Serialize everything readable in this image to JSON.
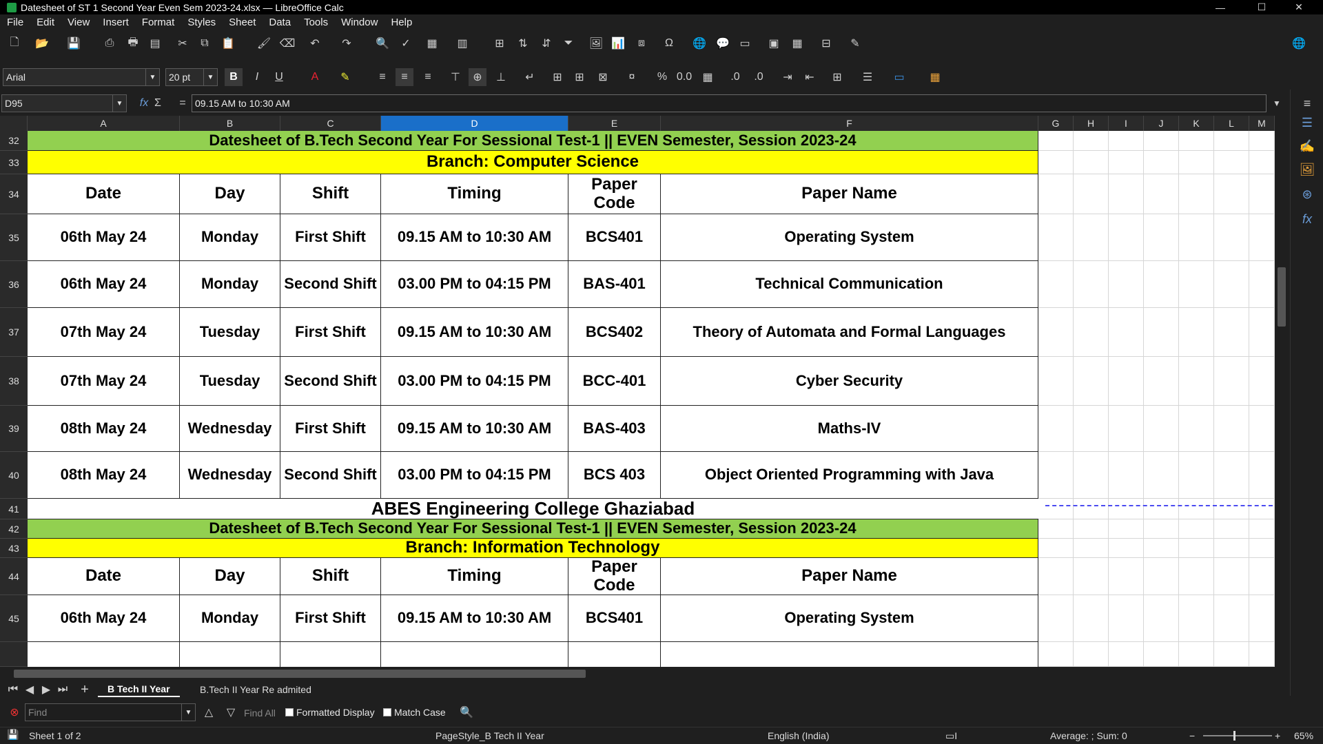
{
  "window": {
    "title": "Datesheet of ST 1 Second Year Even Sem 2023-24.xlsx — LibreOffice Calc",
    "minimize": "—",
    "maximize": "☐",
    "close": "✕"
  },
  "menu": [
    "File",
    "Edit",
    "View",
    "Insert",
    "Format",
    "Styles",
    "Sheet",
    "Data",
    "Tools",
    "Window",
    "Help"
  ],
  "formatting": {
    "font_name": "Arial",
    "font_size": "20 pt",
    "bold": "B",
    "italic": "I",
    "underline": "U"
  },
  "formula_bar": {
    "cell_ref": "D95",
    "content": "09.15 AM to 10:30 AM",
    "fx": "fx",
    "sigma": "Σ",
    "equals": "="
  },
  "columns": [
    "A",
    "B",
    "C",
    "D",
    "E",
    "F",
    "G",
    "H",
    "I",
    "J",
    "K",
    "L",
    "M"
  ],
  "rows": [
    "32",
    "33",
    "34",
    "35",
    "36",
    "37",
    "38",
    "39",
    "40",
    "41",
    "42",
    "43",
    "44",
    "45"
  ],
  "sheet": {
    "r32_title": "Datesheet of B.Tech Second Year For Sessional Test-1 || EVEN Semester, Session 2023-24",
    "r33_branch": "Branch: Computer Science",
    "headers": [
      "Date",
      "Day",
      "Shift",
      "Timing",
      "Paper Code",
      "Paper Name"
    ],
    "cs_rows": [
      [
        "06th May 24",
        "Monday",
        "First Shift",
        "09.15 AM to 10:30 AM",
        "BCS401",
        "Operating System"
      ],
      [
        "06th May 24",
        "Monday",
        "Second Shift",
        "03.00 PM to 04:15 PM",
        "BAS-401",
        "Technical Communication"
      ],
      [
        "07th May 24",
        "Tuesday",
        "First Shift",
        "09.15 AM to 10:30 AM",
        "BCS402",
        "Theory of Automata and Formal Languages"
      ],
      [
        "07th May 24",
        "Tuesday",
        "Second Shift",
        "03.00 PM to 04:15 PM",
        "BCC-401",
        "Cyber Security"
      ],
      [
        "08th May 24",
        "Wednesday",
        "First Shift",
        "09.15 AM to 10:30 AM",
        "BAS-403",
        "Maths-IV"
      ],
      [
        "08th May 24",
        "Wednesday",
        "Second Shift",
        "03.00 PM to 04:15 PM",
        "BCS 403",
        "Object Oriented Programming with Java"
      ]
    ],
    "r41_college": "ABES Engineering College Ghaziabad",
    "r42_title": "Datesheet of B.Tech Second Year For Sessional Test-1 || EVEN Semester, Session 2023-24",
    "r43_branch": "Branch: Information Technology",
    "it_headers": [
      "Date",
      "Day",
      "Shift",
      "Timing",
      "Paper Code",
      "Paper Name"
    ],
    "it_rows": [
      [
        "06th May 24",
        "Monday",
        "First Shift",
        "09.15 AM to 10:30 AM",
        "BCS401",
        "Operating System"
      ]
    ]
  },
  "tabs": {
    "sheet1": "B Tech II Year",
    "sheet2": "B.Tech II Year Re admited"
  },
  "find": {
    "placeholder": "Find",
    "find_all": "Find All",
    "formatted_display": "Formatted Display",
    "match_case": "Match Case"
  },
  "status": {
    "sheet": "Sheet 1 of 2",
    "page_style": "PageStyle_B Tech II Year",
    "language": "English (India)",
    "summary": "Average: ; Sum: 0",
    "zoom": "65%"
  },
  "colors": {
    "green": "#92d050",
    "yellow": "#ffff00",
    "selected_col": "#1a6fc9"
  }
}
